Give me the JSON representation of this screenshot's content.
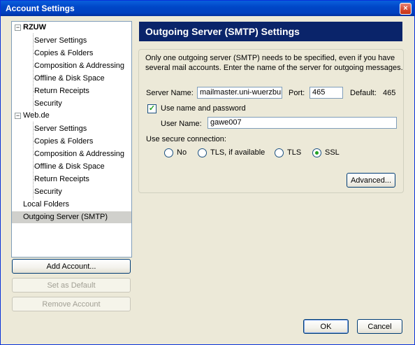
{
  "window": {
    "title": "Account Settings",
    "close_symbol": "×"
  },
  "tree": {
    "accounts": [
      {
        "name": "RZUW",
        "expander": "−",
        "children": [
          "Server Settings",
          "Copies & Folders",
          "Composition & Addressing",
          "Offline & Disk Space",
          "Return Receipts",
          "Security"
        ]
      },
      {
        "name": "Web.de",
        "expander": "−",
        "children": [
          "Server Settings",
          "Copies & Folders",
          "Composition & Addressing",
          "Offline & Disk Space",
          "Return Receipts",
          "Security"
        ]
      }
    ],
    "local_folders": "Local Folders",
    "outgoing_server": "Outgoing Server (SMTP)"
  },
  "left_buttons": {
    "add_account": "Add Account...",
    "set_default": "Set as Default",
    "remove_account": "Remove Account"
  },
  "panel": {
    "header": "Outgoing Server (SMTP) Settings",
    "description_line1": "Only one outgoing server (SMTP) needs to be specified, even if you have",
    "description_line2": "several mail accounts. Enter the name of the server for outgoing messages.",
    "server_name_label": "Server Name:",
    "server_name_value": "mailmaster.uni-wuerzburg.de",
    "port_label": "Port:",
    "port_value": "465",
    "default_label": "Default:",
    "default_value": "465",
    "use_auth_label": "Use name and password",
    "use_auth_checked": true,
    "user_name_label": "User Name:",
    "user_name_value": "gawe007",
    "secure_label": "Use secure connection:",
    "secure_options": [
      "No",
      "TLS, if available",
      "TLS",
      "SSL"
    ],
    "secure_selected": "SSL",
    "advanced_button": "Advanced..."
  },
  "dialog_buttons": {
    "ok": "OK",
    "cancel": "Cancel"
  },
  "colors": {
    "header_bg": "#0a246a",
    "title_bar": "#0047c8",
    "check_green": "#21a121"
  }
}
